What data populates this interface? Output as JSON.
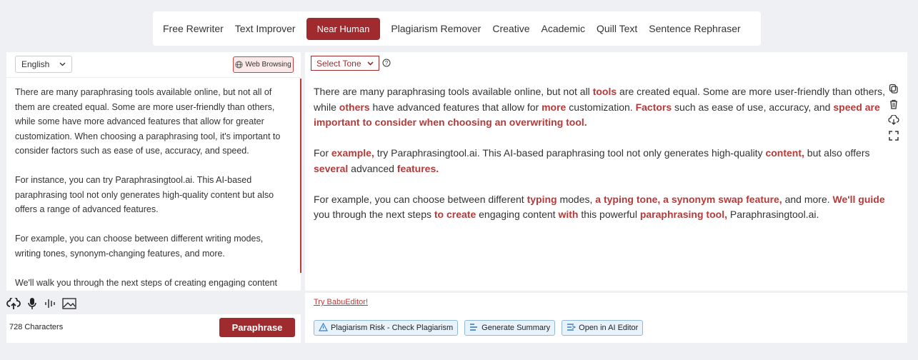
{
  "tabs": [
    {
      "label": "Free Rewriter",
      "active": false
    },
    {
      "label": "Text Improver",
      "active": false
    },
    {
      "label": "Near Human",
      "active": true
    },
    {
      "label": "Plagiarism Remover",
      "active": false
    },
    {
      "label": "Creative",
      "active": false
    },
    {
      "label": "Academic",
      "active": false
    },
    {
      "label": "Quill Text",
      "active": false
    },
    {
      "label": "Sentence Rephraser",
      "active": false
    }
  ],
  "input": {
    "language": "English",
    "web_browsing_label": "Web Browsing",
    "paragraphs": [
      "There are many paraphrasing tools available online, but not all of them are created equal. Some are more user-friendly than others, while some have more advanced features that allow for greater customization. When choosing a paraphrasing tool, it's important to consider factors such as ease of use, accuracy, and speed.",
      "For instance, you can try Paraphrasingtool.ai. This AI-based paraphrasing tool not only generates high-quality content but also offers a range of advanced features.",
      "For example, you can choose between different writing modes, writing tones, synonym-changing features, and more.",
      "We'll walk you through the next steps of creating engaging content"
    ],
    "char_count": "728 Characters",
    "paraphrase_label": "Paraphrase"
  },
  "output": {
    "tone_label": "Select Tone",
    "paragraphs": [
      [
        {
          "t": "There are many paraphrasing tools available online, but not all ",
          "h": false
        },
        {
          "t": "tools",
          "h": true
        },
        {
          "t": " are created equal. Some are more user-friendly than others, while ",
          "h": false
        },
        {
          "t": "others",
          "h": true
        },
        {
          "t": " have advanced features that allow for ",
          "h": false
        },
        {
          "t": "more",
          "h": true
        },
        {
          "t": " customization. ",
          "h": false
        },
        {
          "t": "Factors",
          "h": true
        },
        {
          "t": " such as ease of use, accuracy, and ",
          "h": false
        },
        {
          "t": "speed are important to consider when choosing an overwriting tool.",
          "h": true
        }
      ],
      [
        {
          "t": "For ",
          "h": false
        },
        {
          "t": "example,",
          "h": true
        },
        {
          "t": " try Paraphrasingtool.ai. This AI-based paraphrasing tool not only generates high-quality ",
          "h": false
        },
        {
          "t": "content,",
          "h": true
        },
        {
          "t": " but also offers ",
          "h": false
        },
        {
          "t": "several",
          "h": true
        },
        {
          "t": " advanced ",
          "h": false
        },
        {
          "t": "features.",
          "h": true
        }
      ],
      [
        {
          "t": "For example, you can choose between different ",
          "h": false
        },
        {
          "t": "typing",
          "h": true
        },
        {
          "t": " modes, ",
          "h": false
        },
        {
          "t": "a typing tone, a synonym swap feature,",
          "h": true
        },
        {
          "t": " and more. ",
          "h": false
        },
        {
          "t": "We'll guide",
          "h": true
        },
        {
          "t": " you through the next steps ",
          "h": false
        },
        {
          "t": "to create",
          "h": true
        },
        {
          "t": " engaging content ",
          "h": false
        },
        {
          "t": "with",
          "h": true
        },
        {
          "t": " this powerful ",
          "h": false
        },
        {
          "t": "paraphrasing tool,",
          "h": true
        },
        {
          "t": " Paraphrasingtool.ai.",
          "h": false
        }
      ]
    ],
    "try_link": "Try BabuEditor!",
    "actions": [
      {
        "label": "Plagiarism Risk - Check Plagiarism",
        "icon": "warning-icon"
      },
      {
        "label": "Generate Summary",
        "icon": "summary-icon"
      },
      {
        "label": "Open in AI Editor",
        "icon": "editor-icon"
      }
    ]
  },
  "colors": {
    "accent": "#a02b2e",
    "highlight": "#b53a3a"
  }
}
